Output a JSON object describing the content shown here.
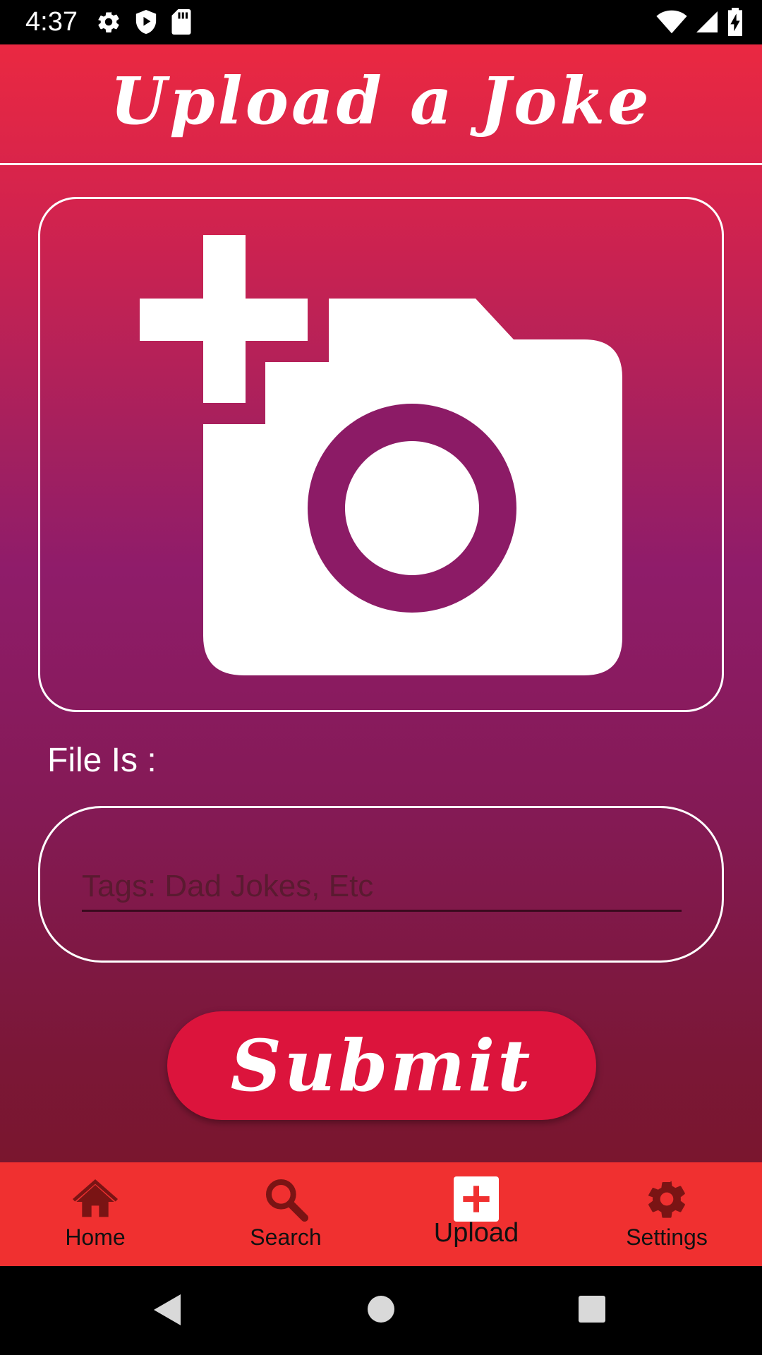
{
  "status_bar": {
    "time": "4:37"
  },
  "header": {
    "title": "Upload a Joke"
  },
  "image_picker": {
    "icon": "add-a-photo-icon"
  },
  "file_label": "File Is :",
  "tags_input": {
    "placeholder": "Tags: Dad Jokes, Etc",
    "value": ""
  },
  "submit_label": "Submit",
  "bottom_nav": {
    "items": [
      {
        "label": "Home",
        "icon": "home-icon",
        "active": false
      },
      {
        "label": "Search",
        "icon": "search-icon",
        "active": false
      },
      {
        "label": "Upload",
        "icon": "add-box-icon",
        "active": true
      },
      {
        "label": "Settings",
        "icon": "gear-icon",
        "active": false
      }
    ]
  },
  "colors": {
    "header_red": "#f02a3e",
    "gradient_mid": "#8f1c6a",
    "gradient_bottom": "#78151e",
    "submit_button": "#dc143c",
    "nav_background": "#f03030",
    "nav_icon": "#7a1414"
  }
}
